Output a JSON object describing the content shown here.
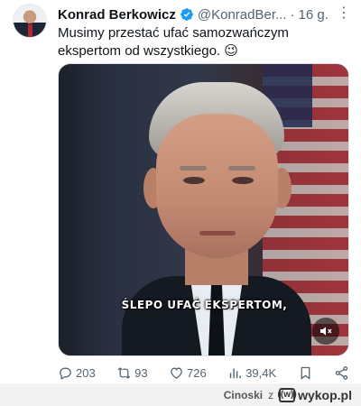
{
  "tweet": {
    "author_name": "Konrad Berkowicz",
    "handle": "@KonradBer...",
    "separator": "·",
    "time": "16 g.",
    "more_icon": "more-dots-icon",
    "text": "Musimy przestać ufać samozwańczym ekspertom od wszystkiego. 😉",
    "media": {
      "subtitle": "ŚLEPO UFAĆ EKSPERTOM,"
    },
    "actions": {
      "replies": "203",
      "retweets": "93",
      "likes": "726",
      "views": "39,4K"
    }
  },
  "footer": {
    "user": "Cinoski",
    "connector": "z",
    "site": "wykop.pl",
    "logo_mark": "((w))"
  },
  "colors": {
    "verified_blue": "#1d9bf0",
    "muted_text": "#536471"
  }
}
